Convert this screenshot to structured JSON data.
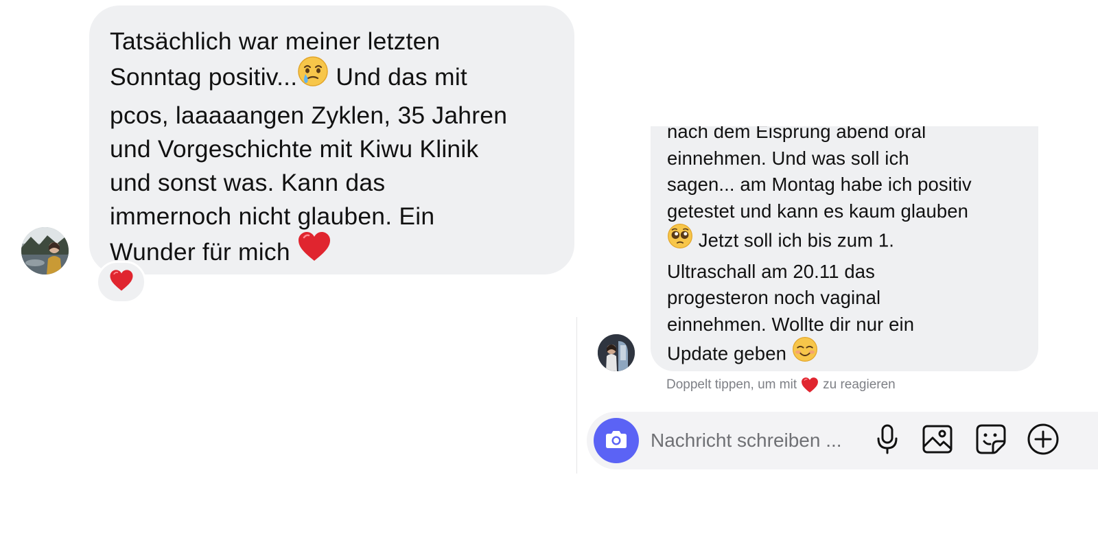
{
  "left_message": {
    "lines": [
      "Tatsächlich war meiner letzten",
      "Sonntag positiv...",
      " Und das mit",
      "pcos, laaaaangen Zyklen, 35 Jahren",
      "und Vorgeschichte mit Kiwu Klinik",
      "und sonst was. Kann das",
      "immernoch nicht glauben. Ein",
      "Wunder für mich "
    ],
    "inline_emojis": [
      "face-holding-back-tears-icon",
      "red-heart-icon"
    ],
    "reaction": "red-heart-icon"
  },
  "right_message": {
    "lines": [
      "nach dem Eisprung abend oral",
      "einnehmen. Und was soll ich",
      "sagen... am Montag habe ich positiv",
      "getestet und kann es kaum glauben",
      " Jetzt soll ich bis zum 1.",
      "Ultraschall am 20.11 das",
      "progesteron noch vaginal",
      "einnehmen. Wollte dir nur ein",
      "Update geben "
    ],
    "inline_emojis": [
      "pleading-face-icon",
      "smiling-face-icon"
    ]
  },
  "reaction_hint": {
    "before": "Doppelt tippen, um mit",
    "after": "zu reagieren"
  },
  "composer": {
    "placeholder": "Nachricht schreiben ...",
    "icons": [
      "camera-icon",
      "microphone-icon",
      "gallery-icon",
      "sticker-icon",
      "add-icon"
    ]
  },
  "colors": {
    "bubble": "#eff0f2",
    "camera_button": "#5b63f5",
    "heart": "#e0252f",
    "hint_text": "#7d7f85"
  }
}
